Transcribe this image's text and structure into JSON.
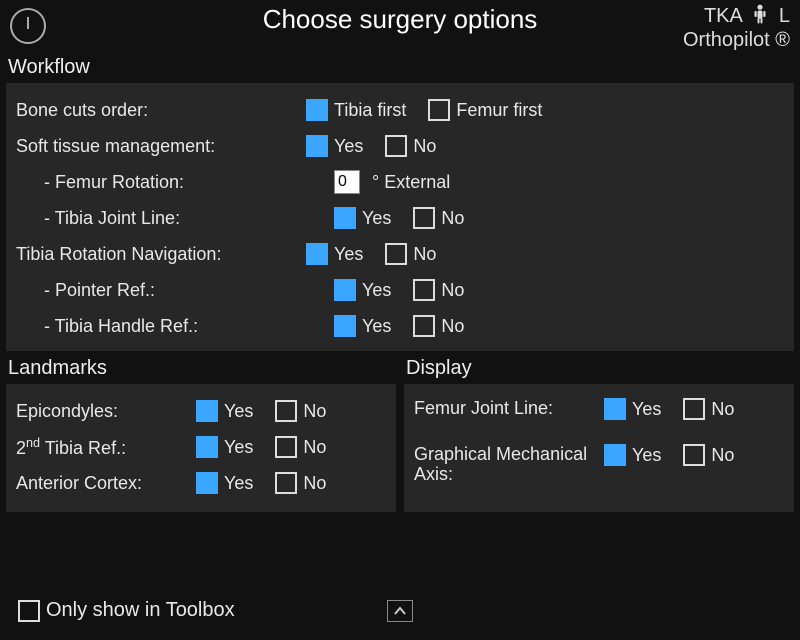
{
  "header": {
    "title": "Choose surgery options",
    "procedure": "TKA",
    "side": "L",
    "system": "Orthopilot ®"
  },
  "sections": {
    "workflow": "Workflow",
    "landmarks": "Landmarks",
    "display": "Display"
  },
  "workflow": {
    "bone_cuts": {
      "label": "Bone cuts order:",
      "tibia_first": "Tibia first",
      "femur_first": "Femur first"
    },
    "stm": {
      "label": "Soft tissue management:",
      "yes": "Yes",
      "no": "No"
    },
    "femur_rot": {
      "label": "- Femur Rotation:",
      "value": "0",
      "suffix": "° External"
    },
    "tjl": {
      "label": "- Tibia Joint Line:",
      "yes": "Yes",
      "no": "No"
    },
    "trn": {
      "label": "Tibia Rotation Navigation:",
      "yes": "Yes",
      "no": "No"
    },
    "pointer": {
      "label": "- Pointer Ref.:",
      "yes": "Yes",
      "no": "No"
    },
    "handle": {
      "label": "- Tibia Handle Ref.:",
      "yes": "Yes",
      "no": "No"
    }
  },
  "landmarks": {
    "epicondyles": {
      "label": "Epicondyles:",
      "yes": "Yes",
      "no": "No"
    },
    "second_tibia": {
      "label_html": "2<sup>nd</sup> Tibia Ref.:",
      "yes": "Yes",
      "no": "No"
    },
    "ant_cortex": {
      "label": "Anterior Cortex:",
      "yes": "Yes",
      "no": "No"
    }
  },
  "display": {
    "fjl": {
      "label": "Femur Joint Line:",
      "yes": "Yes",
      "no": "No"
    },
    "gma": {
      "label": "Graphical Mechanical Axis:",
      "yes": "Yes",
      "no": "No"
    }
  },
  "footer": {
    "toolbox": "Only show in Toolbox"
  }
}
